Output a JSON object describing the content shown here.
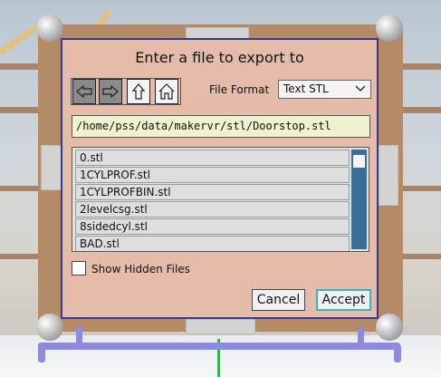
{
  "dialog": {
    "title": "Enter a file to export to",
    "nav": [
      {
        "icon": "back-arrow-icon"
      },
      {
        "icon": "forward-arrow-icon"
      },
      {
        "icon": "up-arrow-icon"
      },
      {
        "icon": "home-icon"
      }
    ],
    "file_format_label": "File Format",
    "file_format_value": "Text STL",
    "path_value": "/home/pss/data/makervr/stl/Doorstop.stl",
    "files": [
      "0.stl",
      "1CYLPROF.stl",
      "1CYLPROFBIN.stl",
      "2levelcsg.stl",
      "8sidedcyl.stl",
      "BAD.stl"
    ],
    "show_hidden_label": "Show Hidden Files",
    "show_hidden_checked": false,
    "cancel_label": "Cancel",
    "accept_label": "Accept"
  },
  "colors": {
    "dialog_bg": "#e5bcaa",
    "dialog_border": "#3a3a8c",
    "path_bg": "#eef2cf",
    "scrollbar": "#3b6d99",
    "accept_border": "#34b4c4",
    "frame": "#b48a67"
  }
}
